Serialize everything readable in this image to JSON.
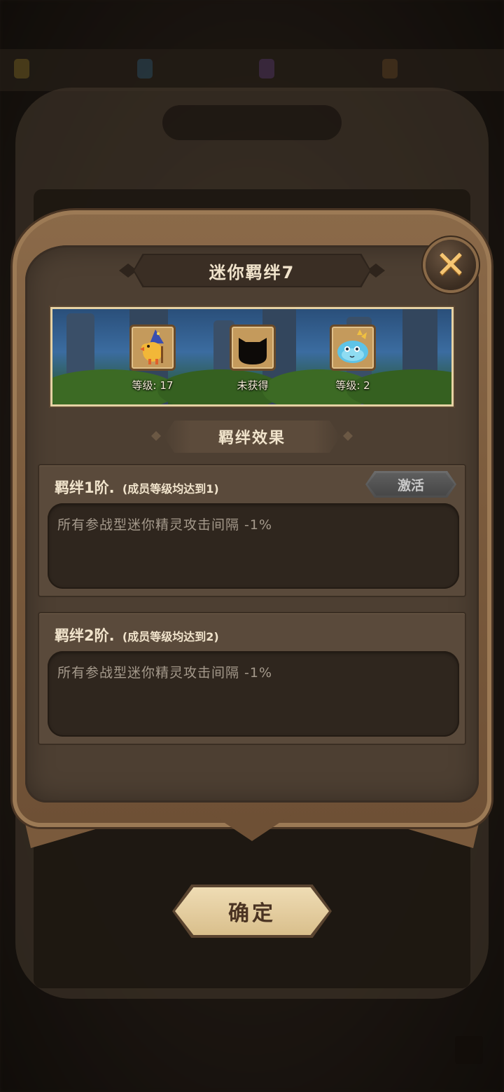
{
  "dialog": {
    "title": "迷你羁绊7",
    "close_icon": "close-x-icon"
  },
  "members": [
    {
      "icon": "duck-wizard-pet-icon",
      "label": "等级: 17",
      "acquired": true
    },
    {
      "icon": "locked-silhouette-icon",
      "label": "未获得",
      "acquired": false
    },
    {
      "icon": "blue-blob-pet-icon",
      "label": "等级: 2",
      "acquired": true
    }
  ],
  "effects": {
    "header": "羁绊效果",
    "tiers": [
      {
        "title": "羁绊1阶.",
        "condition": "(成员等级均达到1)",
        "description": "所有参战型迷你精灵攻击间隔 -1%",
        "button_label": "激活"
      },
      {
        "title": "羁绊2阶.",
        "condition": "(成员等级均达到2)",
        "description": "所有参战型迷你精灵攻击间隔 -1%"
      }
    ]
  },
  "confirm_label": "确定",
  "colors": {
    "frame": "#7a5a3c",
    "panel": "#4d3f32",
    "text_light": "#f1e4cc",
    "text_muted": "#a59a8c",
    "confirm_bg": "#e3cd9f",
    "disabled_button": "#5e5e5e",
    "accent_orange": "#f5c572"
  }
}
